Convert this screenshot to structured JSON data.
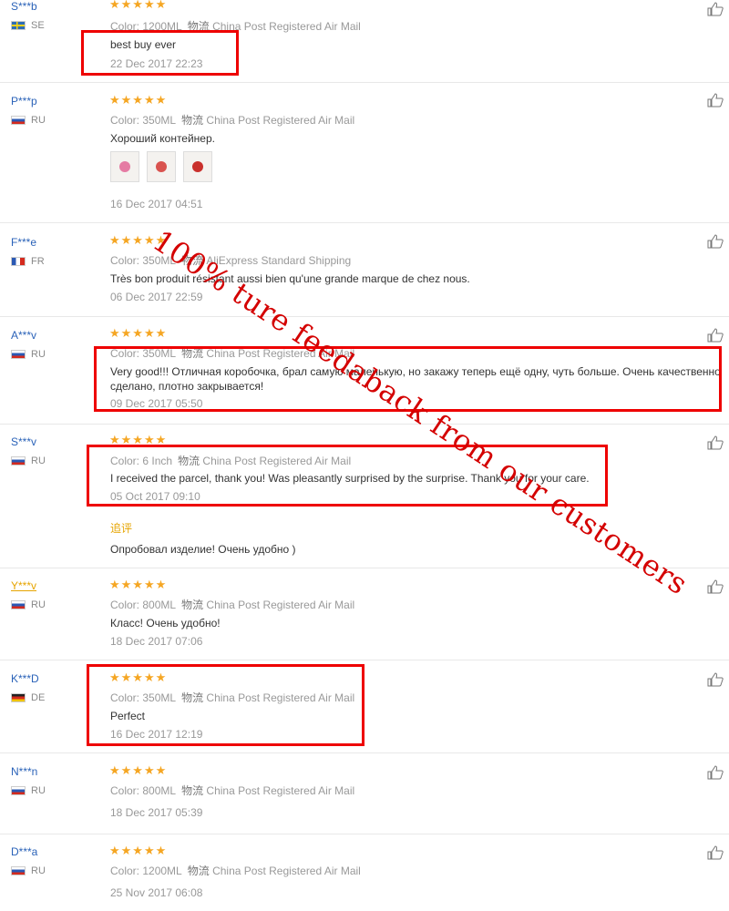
{
  "reviews": [
    {
      "user": "S***b",
      "country": "SE",
      "flag": "se",
      "color_label": "Color:",
      "color_value": "1200ML",
      "ship_label": "物流",
      "shipping": "China Post Registered Air Mail",
      "text": "best buy ever",
      "date": "22 Dec 2017 22:23",
      "stars": "★★★★★"
    },
    {
      "user": "P***p",
      "country": "RU",
      "flag": "ru",
      "color_label": "Color:",
      "color_value": "350ML",
      "ship_label": "物流",
      "shipping": "China Post Registered Air Mail",
      "text": "Хороший контейнер.",
      "date": "16 Dec 2017 04:51",
      "stars": "★★★★★"
    },
    {
      "user": "F***e",
      "country": "FR",
      "flag": "fr",
      "color_label": "Color:",
      "color_value": "350ML",
      "ship_label": "物流",
      "shipping": "AliExpress Standard Shipping",
      "text": "Très bon produit résistant aussi bien qu'une grande marque de chez nous.",
      "date": "06 Dec 2017 22:59",
      "stars": "★★★★★"
    },
    {
      "user": "A***v",
      "country": "RU",
      "flag": "ru",
      "color_label": "Color:",
      "color_value": "350ML",
      "ship_label": "物流",
      "shipping": "China Post Registered Air Mail",
      "text": "Very good!!! Отличная коробочка, брал самую маленькую, но закажу теперь ещё одну, чуть больше. Очень качественно",
      "text2": "сделано, плотно закрывается!",
      "date": "09 Dec 2017 05:50",
      "stars": "★★★★★"
    },
    {
      "user": "S***v",
      "country": "RU",
      "flag": "ru",
      "color_label": "Color:",
      "color_value": "6 Inch",
      "ship_label": "物流",
      "shipping": "China Post Registered Air Mail",
      "text": "I received the parcel, thank you! Was pleasantly surprised by the surprise. Thank you for your care.",
      "date": "05 Oct 2017 09:10",
      "stars": "★★★★★",
      "additional_label": "追评",
      "additional_text": "Опробовал изделие! Очень удобно )"
    },
    {
      "user": "Y***v",
      "country": "RU",
      "flag": "ru",
      "color_label": "Color:",
      "color_value": "800ML",
      "ship_label": "物流",
      "shipping": "China Post Registered Air Mail",
      "text": "Класс! Очень удобно!",
      "date": "18 Dec 2017 07:06",
      "stars": "★★★★★"
    },
    {
      "user": "K***D",
      "country": "DE",
      "flag": "de",
      "color_label": "Color:",
      "color_value": "350ML",
      "ship_label": "物流",
      "shipping": "China Post Registered Air Mail",
      "text": "Perfect",
      "date": "16 Dec 2017 12:19",
      "stars": "★★★★★"
    },
    {
      "user": "N***n",
      "country": "RU",
      "flag": "ru",
      "color_label": "Color:",
      "color_value": "800ML",
      "ship_label": "物流",
      "shipping": "China Post Registered Air Mail",
      "text": "",
      "date": "18 Dec 2017 05:39",
      "stars": "★★★★★"
    },
    {
      "user": "D***a",
      "country": "RU",
      "flag": "ru",
      "color_label": "Color:",
      "color_value": "1200ML",
      "ship_label": "物流",
      "shipping": "China Post Registered Air Mail",
      "text": "",
      "date": "25 Nov 2017 06:08",
      "stars": "★★★★★"
    }
  ],
  "watermark": "100% ture feedaback from our customers",
  "colors": {
    "highlight_box": "#e00000",
    "star": "#f5a623",
    "username": "#2a62b8"
  },
  "icons": {
    "helpful": "thumbs-up-icon"
  }
}
